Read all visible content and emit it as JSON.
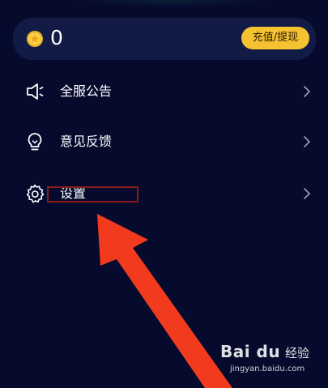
{
  "balance": {
    "value": "0",
    "action_label": "充值/提现"
  },
  "menu": {
    "items": [
      {
        "label": "全服公告",
        "icon": "megaphone-icon"
      },
      {
        "label": "意见反馈",
        "icon": "lightbulb-icon"
      },
      {
        "label": "设置",
        "icon": "gear-icon"
      }
    ]
  },
  "watermark": {
    "logo": "Bai du",
    "cn": "经验",
    "url": "jingyan.baidu.com"
  },
  "colors": {
    "background": "#060a2c",
    "card": "#121a46",
    "accent_button": "#f5c232",
    "annotation_arrow": "#f23a1e",
    "annotation_box": "#8b1a1a"
  }
}
